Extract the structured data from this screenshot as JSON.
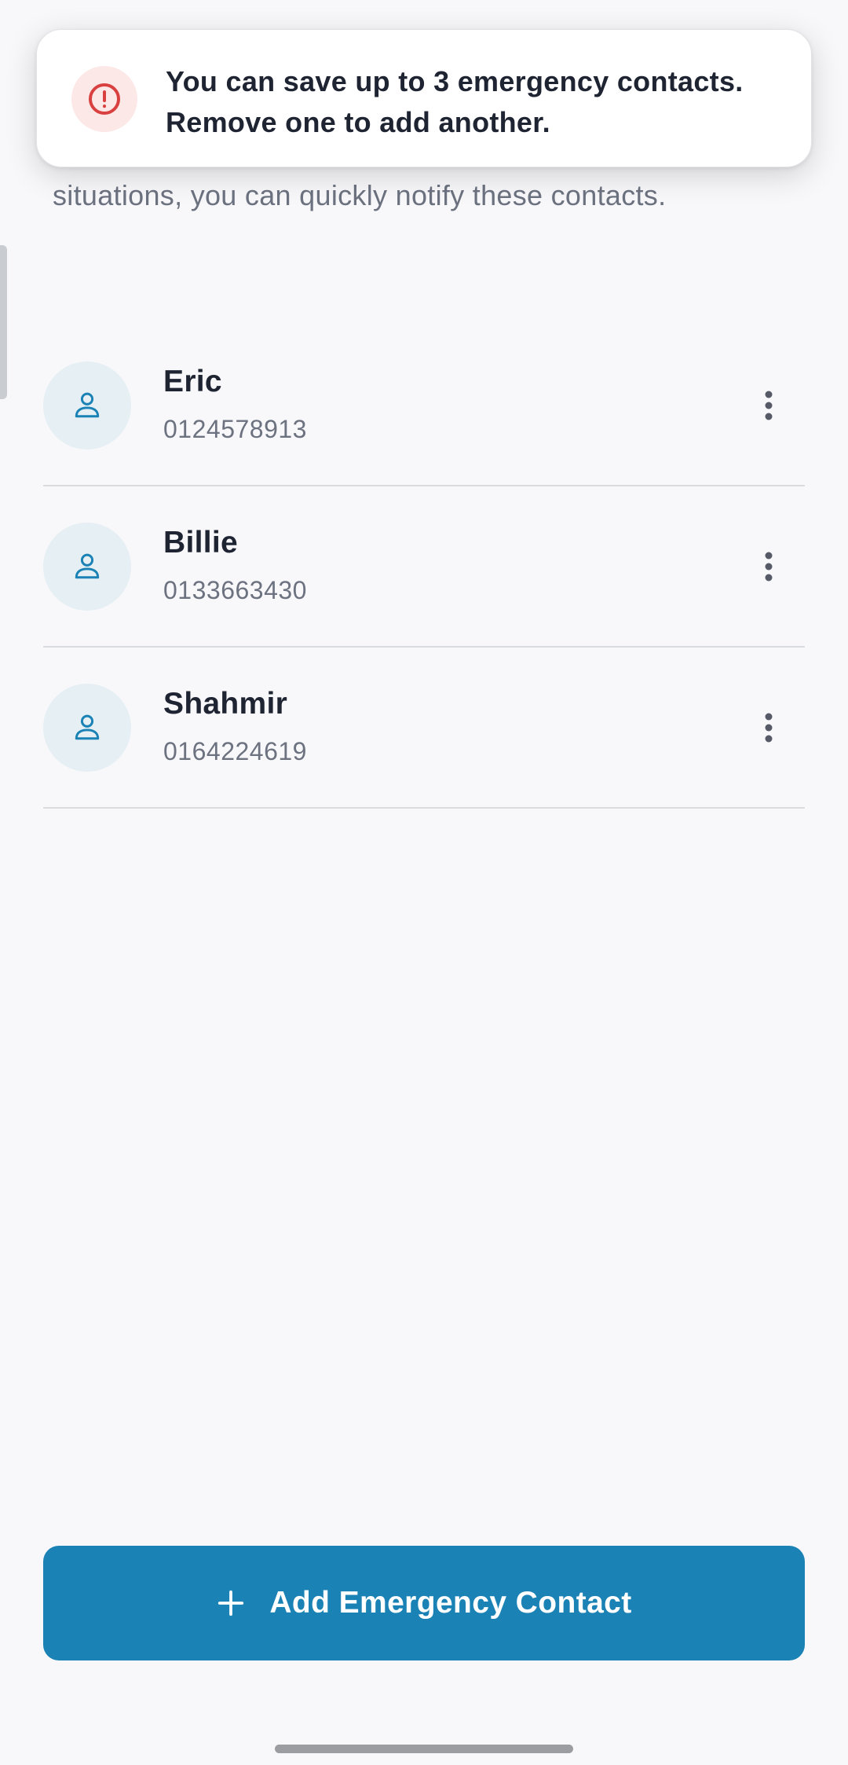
{
  "description": {
    "text": "Manage your personal SOS contact list. In emergency situations, you can quickly notify these contacts."
  },
  "toast": {
    "icon": "alert-circle-icon",
    "message": "You can save up to 3 emergency contacts. Remove one to add another."
  },
  "contacts": [
    {
      "name": "Eric",
      "phone": "0124578913",
      "icon": "user-icon"
    },
    {
      "name": "Billie",
      "phone": "0133663430",
      "icon": "user-icon"
    },
    {
      "name": "Shahmir",
      "phone": "0164224619",
      "icon": "user-icon"
    }
  ],
  "add_button": {
    "label": "Add Emergency Contact",
    "icon": "plus-icon"
  },
  "colors": {
    "primary": "#1a82b5",
    "error": "#d94141",
    "background": "#f8f8fa"
  }
}
